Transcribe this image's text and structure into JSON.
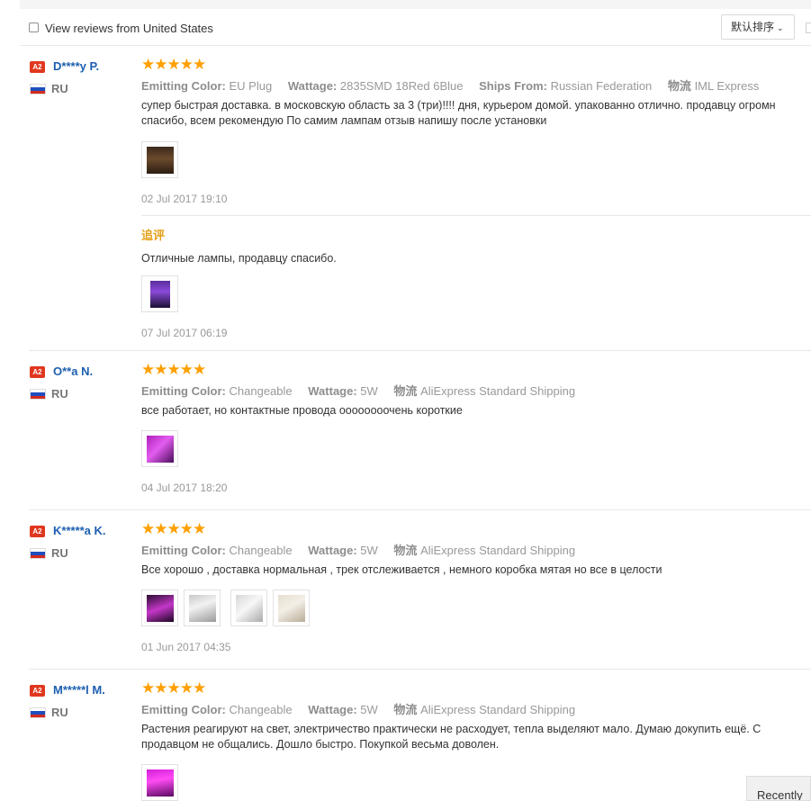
{
  "filter": {
    "label": "View reviews from United States",
    "sort_label": "默认排序"
  },
  "reviews": [
    {
      "badge": "A2",
      "name": "D****y P.",
      "country": "RU",
      "stars": "★★★★★",
      "attrs": [
        {
          "k": "Emitting Color:",
          "v": "EU Plug"
        },
        {
          "k": "Wattage:",
          "v": "2835SMD 18Red 6Blue"
        },
        {
          "k": "Ships From:",
          "v": "Russian Federation"
        },
        {
          "k": "物流",
          "v": "IML Express"
        }
      ],
      "text": "супер быстрая доставка. в московскую область за 3 (три)!!!! дня, курьером домой. упакованно отлично. продавцу огромн спасибо, всем рекомендую По самим лампам отзыв напишу после установки",
      "date": "02 Jul 2017 19:10",
      "followup": {
        "label": "追评",
        "text": "Отличные лампы, продавцу спасибо.",
        "date": "07 Jul 2017 06:19"
      }
    },
    {
      "badge": "A2",
      "name": "O**a N.",
      "country": "RU",
      "stars": "★★★★★",
      "attrs": [
        {
          "k": "Emitting Color:",
          "v": "Changeable"
        },
        {
          "k": "Wattage:",
          "v": "5W"
        },
        {
          "k": "物流",
          "v": "AliExpress Standard Shipping"
        }
      ],
      "text": "все работает, но контактные провода оооооооочень короткие",
      "date": "04 Jul 2017 18:20"
    },
    {
      "badge": "A2",
      "name": "K*****a K.",
      "country": "RU",
      "stars": "★★★★★",
      "attrs": [
        {
          "k": "Emitting Color:",
          "v": "Changeable"
        },
        {
          "k": "Wattage:",
          "v": "5W"
        },
        {
          "k": "物流",
          "v": "AliExpress Standard Shipping"
        }
      ],
      "text": "Все хорошо , доставка нормальная , трек отслеживается , немного коробка мятая но все в целости",
      "date": "01 Jun 2017 04:35"
    },
    {
      "badge": "A2",
      "name": "M*****l M.",
      "country": "RU",
      "stars": "★★★★★",
      "attrs": [
        {
          "k": "Emitting Color:",
          "v": "Changeable"
        },
        {
          "k": "Wattage:",
          "v": "5W"
        },
        {
          "k": "物流",
          "v": "AliExpress Standard Shipping"
        }
      ],
      "text": "Растения реагируют на свет, электричество практически не расходует, тепла выделяют мало. Думаю докупить ещё. С продавцом не общались. Дошло быстро. Покупкой весьма доволен."
    }
  ],
  "recent_label": "Recently",
  "colors": {
    "username": "#1c5fb0",
    "stars": "#ff9f00",
    "badge": "#e0371f",
    "followup": "#e4a11b"
  }
}
